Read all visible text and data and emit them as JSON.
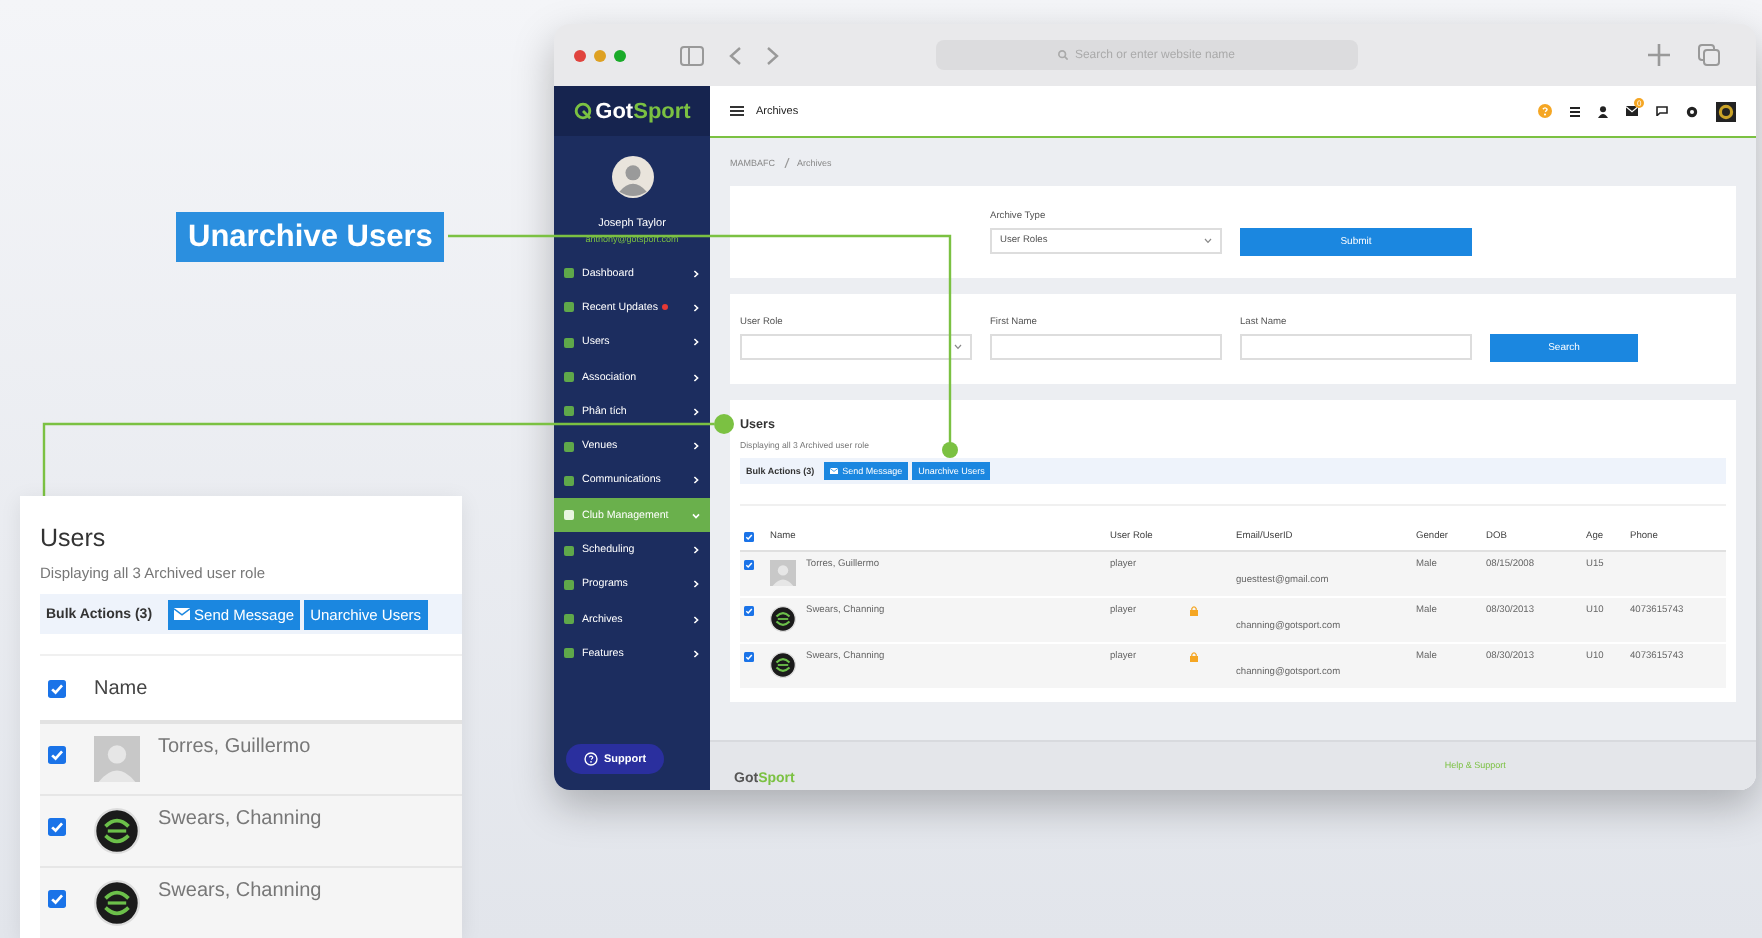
{
  "callout_label": "Unarchive Users",
  "browser": {
    "address_placeholder": "Search or enter website name"
  },
  "sidebar": {
    "logo": {
      "first": "Got",
      "second": "Sport"
    },
    "user_name": "Joseph Taylor",
    "user_email": "anthony@gotsport.com",
    "items": [
      {
        "label": "Dashboard",
        "selected": false,
        "expanded": false,
        "alert": false
      },
      {
        "label": "Recent Updates",
        "selected": false,
        "expanded": false,
        "alert": true
      },
      {
        "label": "Users",
        "selected": false,
        "expanded": false,
        "alert": false
      },
      {
        "label": "Association",
        "selected": false,
        "expanded": false,
        "alert": false
      },
      {
        "label": "Phân tích",
        "selected": false,
        "expanded": false,
        "alert": false
      },
      {
        "label": "Venues",
        "selected": false,
        "expanded": false,
        "alert": false
      },
      {
        "label": "Communications",
        "selected": false,
        "expanded": false,
        "alert": false
      },
      {
        "label": "Club Management",
        "selected": true,
        "expanded": true,
        "alert": false
      },
      {
        "label": "Scheduling",
        "selected": false,
        "expanded": false,
        "alert": false
      },
      {
        "label": "Programs",
        "selected": false,
        "expanded": false,
        "alert": false
      },
      {
        "label": "Archives",
        "selected": false,
        "expanded": false,
        "alert": false
      },
      {
        "label": "Features",
        "selected": false,
        "expanded": false,
        "alert": false
      }
    ],
    "support_button": "Support"
  },
  "topbar": {
    "title": "Archives",
    "mail_badge": "0"
  },
  "breadcrumb": [
    "MAMBAFC",
    "Archives"
  ],
  "archive_form": {
    "label": "Archive Type",
    "value": "User Roles",
    "button": "Submit"
  },
  "search_form": {
    "fields": [
      {
        "label": "User Role",
        "kind": "select"
      },
      {
        "label": "First Name",
        "kind": "text"
      },
      {
        "label": "Last Name",
        "kind": "text"
      }
    ],
    "button": "Search"
  },
  "users": {
    "title": "Users",
    "subtitle": "Displaying all 3 Archived user role",
    "bulk_label": "Bulk Actions (3)",
    "buttons": [
      "Send Message",
      "Unarchive Users"
    ],
    "all_checked": true,
    "columns": [
      "Name",
      "User Role",
      "Email/UserID",
      "Gender",
      "DOB",
      "Age",
      "Phone"
    ],
    "rows": [
      {
        "checked": true,
        "avatar": {
          "kind": "placeholder"
        },
        "name": "Torres, Guillermo",
        "role": "player",
        "locked": false,
        "email": "guesttest@gmail.com",
        "gender": "Male",
        "dob": "08/15/2008",
        "age": "U15",
        "phone": ""
      },
      {
        "checked": true,
        "avatar": {
          "kind": "logo"
        },
        "name": "Swears, Channing",
        "role": "player",
        "locked": true,
        "email": "channing@gotsport.com",
        "gender": "Male",
        "dob": "08/30/2013",
        "age": "U10",
        "phone": "4073615743"
      },
      {
        "checked": true,
        "avatar": {
          "kind": "logo"
        },
        "name": "Swears, Channing",
        "role": "player",
        "locked": true,
        "email": "channing@gotsport.com",
        "gender": "Male",
        "dob": "08/30/2013",
        "age": "U10",
        "phone": "4073615743"
      }
    ]
  },
  "footer": {
    "logo": {
      "first": "Got",
      "second": "Sport"
    },
    "link": "Help & Support"
  },
  "zoom_card": {
    "title": "Users",
    "subtitle": "Displaying all 3 Archived user role",
    "bulk_label": "Bulk Actions (3)",
    "buttons": [
      "Send Message",
      "Unarchive Users"
    ],
    "all_checked": true,
    "column": "Name",
    "rows": [
      {
        "checked": true,
        "avatar": {
          "kind": "placeholder"
        },
        "name": "Torres, Guillermo"
      },
      {
        "checked": true,
        "avatar": {
          "kind": "logo"
        },
        "name": "Swears, Channing"
      },
      {
        "checked": true,
        "avatar": {
          "kind": "logo"
        },
        "name": "Swears, Channing"
      }
    ]
  }
}
